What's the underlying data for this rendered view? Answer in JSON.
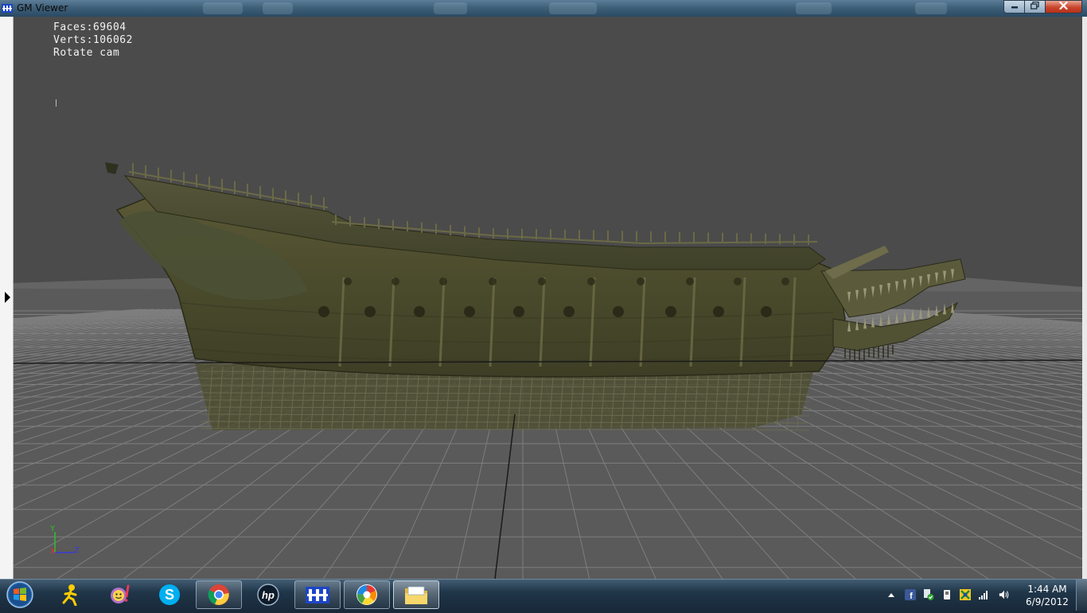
{
  "window": {
    "title": "GM Viewer",
    "icon": "gm-viewer-app-icon",
    "controls": {
      "minimize": "minimize",
      "maximize": "maximize",
      "close": "close"
    }
  },
  "viewer": {
    "faces_text": "Faces:69604",
    "verts_text": "Verts:106062",
    "mode_text": "Rotate cam",
    "axis": {
      "y": "Y",
      "x": "X",
      "z": "Z"
    },
    "colors": {
      "background": "#4b4b4b",
      "floor": "#5a5a5a",
      "grid": "#8c8c8c",
      "hull": "#4c4a2c"
    }
  },
  "taskbar": {
    "start_icon": "windows-start-orb",
    "items": [
      {
        "icon": "aim-running-man-icon",
        "state": "pinned"
      },
      {
        "icon": "messenger-smiley-icon",
        "state": "pinned"
      },
      {
        "icon": "skype-icon",
        "state": "pinned"
      },
      {
        "icon": "chrome-icon",
        "state": "open"
      },
      {
        "icon": "hp-icon",
        "state": "pinned"
      },
      {
        "icon": "gm-viewer-icon",
        "state": "open"
      },
      {
        "icon": "picasa-icon",
        "state": "open"
      },
      {
        "icon": "windows-explorer-icon",
        "state": "active"
      }
    ],
    "tray": {
      "icons": [
        "show-hidden-icons-arrow",
        "facebook-icon",
        "security-check-icon",
        "device-icon",
        "network-flag-icon",
        "signal-bars-icon",
        "volume-icon"
      ],
      "time": "1:44 AM",
      "date": "6/9/2012"
    }
  }
}
